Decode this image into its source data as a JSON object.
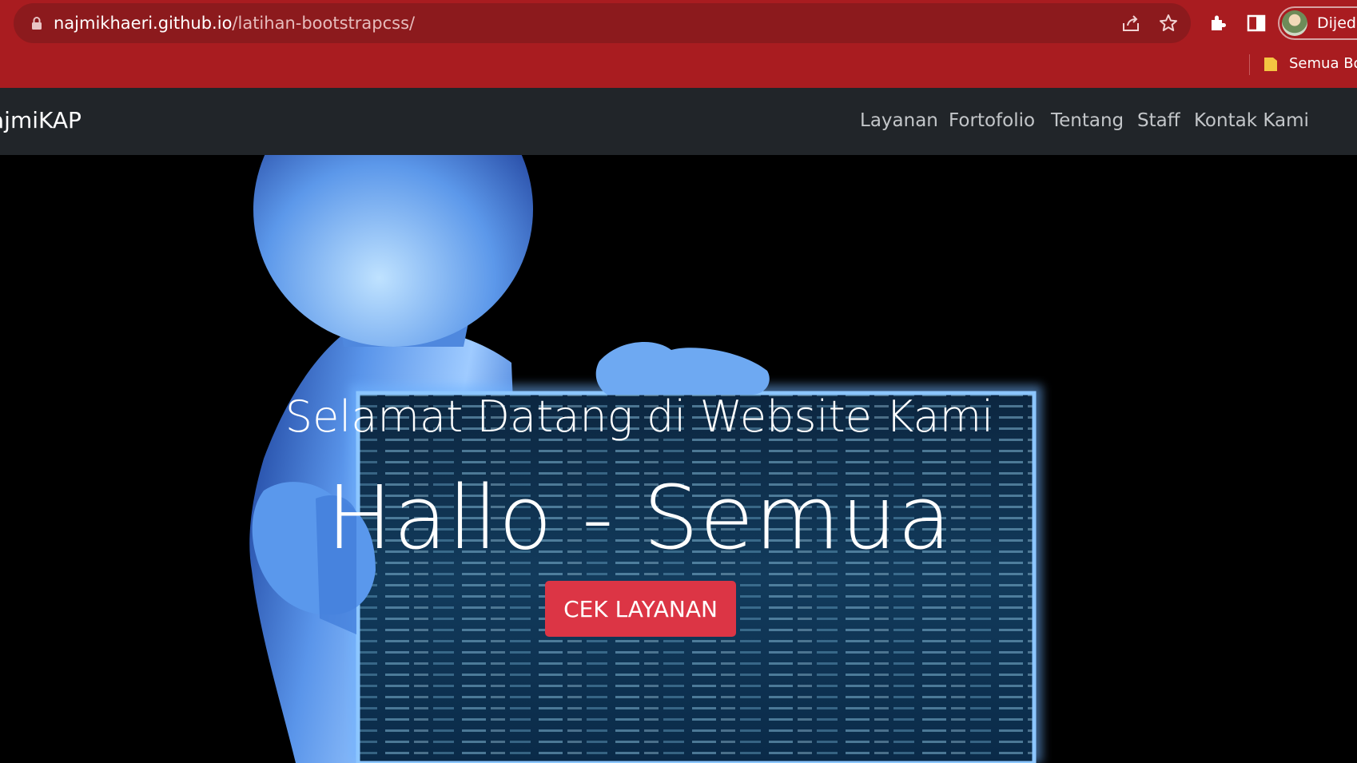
{
  "browser": {
    "url_host": "najmikhaeri.github.io",
    "url_path": "/latihan-bootstrapcss/",
    "profile_status": "Dijeda",
    "bookmark_label": "Semua Boo"
  },
  "navbar": {
    "brand": "ajmiKAP",
    "links": [
      "Layanan",
      "Fortofolio",
      "Tentang",
      "Staff",
      "Kontak Kami"
    ]
  },
  "hero": {
    "subtitle": "Selamat Datang di Website Kami",
    "title": "Hallo - Semua",
    "button": "CEK LAYANAN"
  },
  "colors": {
    "chrome": "#a91c20",
    "navbar": "#212529",
    "button": "#dc3545"
  }
}
